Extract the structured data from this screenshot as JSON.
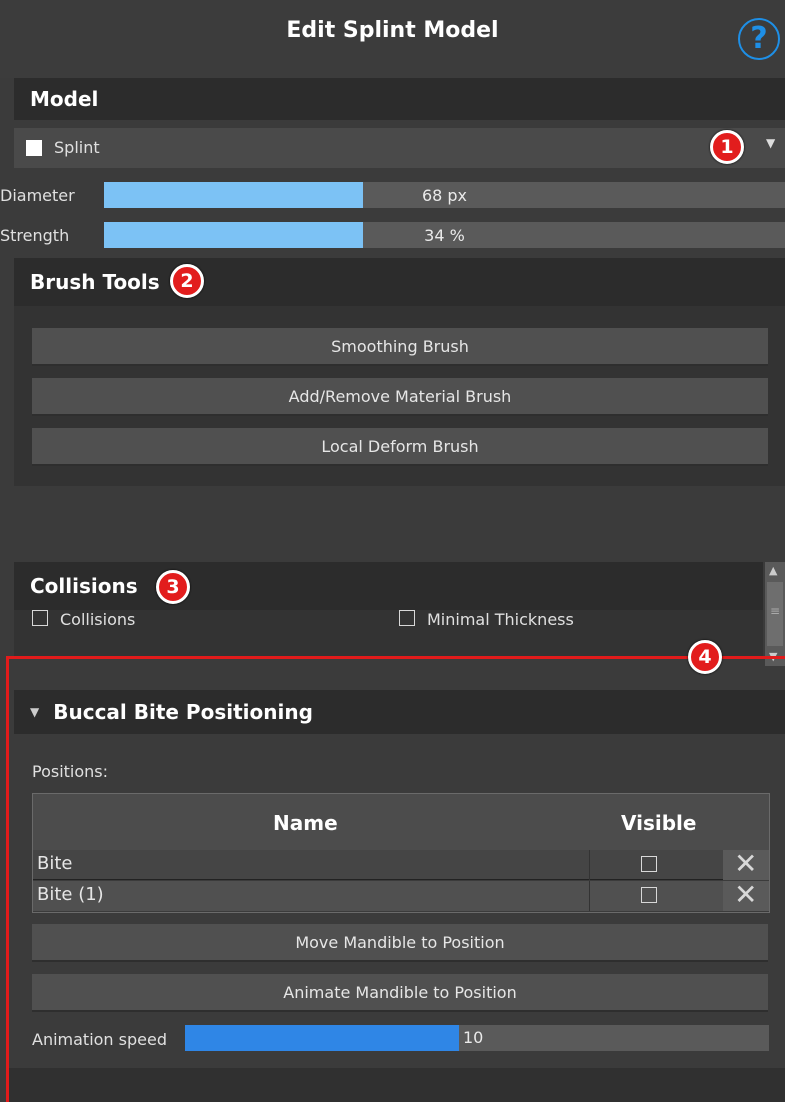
{
  "window": {
    "title": "Edit Splint Model",
    "help_glyph": "?"
  },
  "model": {
    "header": "Model",
    "selector": {
      "checked": true,
      "label": "Splint"
    },
    "diameter": {
      "label": "Diameter",
      "value_text": "68 px",
      "fill_fraction": 0.38
    },
    "strength": {
      "label": "Strength",
      "value_text": "34 %",
      "fill_fraction": 0.38
    }
  },
  "brush_tools": {
    "header": "Brush Tools",
    "buttons": [
      "Smoothing Brush",
      "Add/Remove Material Brush",
      "Local Deform Brush"
    ]
  },
  "collisions": {
    "header": "Collisions",
    "options": [
      {
        "label": "Collisions",
        "checked": false
      },
      {
        "label": "Minimal Thickness",
        "checked": false
      }
    ]
  },
  "buccal": {
    "header": "Buccal Bite Positioning",
    "positions_label": "Positions:",
    "columns": [
      "Name",
      "Visible"
    ],
    "rows": [
      {
        "name": "Bite",
        "visible": false
      },
      {
        "name": "Bite (1)",
        "visible": false
      }
    ],
    "move_button": "Move Mandible to Position",
    "animate_button": "Animate Mandible to Position",
    "animation_speed": {
      "label": "Animation speed",
      "value_text": "10",
      "fill_fraction": 0.47
    }
  },
  "annotations": [
    "1",
    "2",
    "3",
    "4"
  ],
  "colors": {
    "accent_blue": "#1e8fe6",
    "slider_blue": "#7cc2f5",
    "speed_blue": "#2f86e6",
    "annotation_red": "#e21d1d"
  }
}
